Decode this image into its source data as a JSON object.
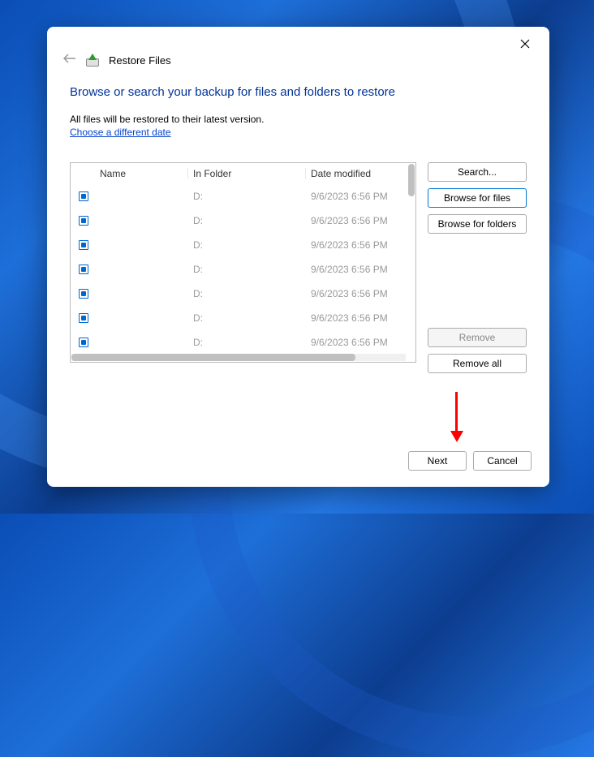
{
  "window": {
    "title": "Restore Files"
  },
  "heading": "Browse or search your backup for files and folders to restore",
  "subtext": "All files will be restored to their latest version.",
  "choose_date_link": "Choose a different date",
  "columns": {
    "name": "Name",
    "folder": "In Folder",
    "date": "Date modified"
  },
  "rows": [
    {
      "name": "",
      "folder": "D:",
      "date": "9/6/2023 6:56 PM"
    },
    {
      "name": "",
      "folder": "D:",
      "date": "9/6/2023 6:56 PM"
    },
    {
      "name": "",
      "folder": "D:",
      "date": "9/6/2023 6:56 PM"
    },
    {
      "name": "",
      "folder": "D:",
      "date": "9/6/2023 6:56 PM"
    },
    {
      "name": "",
      "folder": "D:",
      "date": "9/6/2023 6:56 PM"
    },
    {
      "name": "",
      "folder": "D:",
      "date": "9/6/2023 6:56 PM"
    },
    {
      "name": "",
      "folder": "D:",
      "date": "9/6/2023 6:56 PM"
    }
  ],
  "buttons": {
    "search": "Search...",
    "browse_files": "Browse for files",
    "browse_folders": "Browse for folders",
    "remove": "Remove",
    "remove_all": "Remove all",
    "next": "Next",
    "cancel": "Cancel"
  }
}
